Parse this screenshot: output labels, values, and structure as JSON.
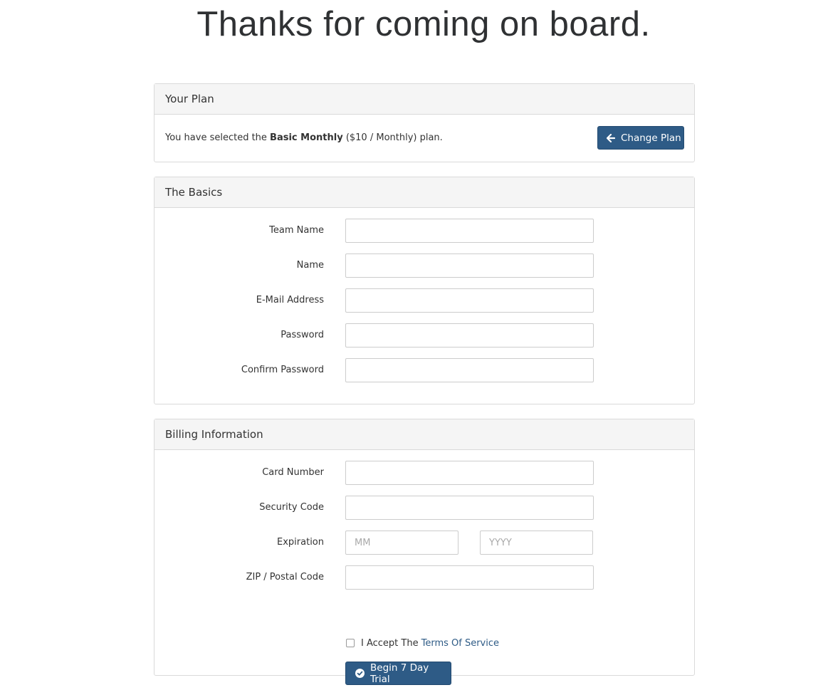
{
  "header": {
    "title": "Thanks for coming on board."
  },
  "plan_panel": {
    "heading": "Your Plan",
    "text_prefix": "You have selected the ",
    "plan_name": "Basic Monthly",
    "text_suffix": " ($10 / Monthly) plan.",
    "change_button_label": "Change Plan",
    "change_button_icon": "arrow-left-icon"
  },
  "basics_panel": {
    "heading": "The Basics",
    "fields": [
      {
        "label": "Team Name",
        "value": "",
        "placeholder": ""
      },
      {
        "label": "Name",
        "value": "",
        "placeholder": ""
      },
      {
        "label": "E-Mail Address",
        "value": "",
        "placeholder": ""
      },
      {
        "label": "Password",
        "value": "",
        "placeholder": ""
      },
      {
        "label": "Confirm Password",
        "value": "",
        "placeholder": ""
      }
    ]
  },
  "billing_panel": {
    "heading": "Billing Information",
    "card_number_label": "Card Number",
    "security_code_label": "Security Code",
    "expiration_label": "Expiration",
    "expiration_month_placeholder": "MM",
    "expiration_year_placeholder": "YYYY",
    "zip_label": "ZIP / Postal Code",
    "terms_prefix": "I Accept The",
    "terms_link": "Terms Of Service",
    "terms_checked": false,
    "submit_label": "Begin 7 Day Trial",
    "submit_icon": "check-circle-icon"
  },
  "colors": {
    "button_primary": "#2e5b86",
    "link": "#2e5b86",
    "panel_heading_bg": "#f5f5f5",
    "border": "#dadada"
  }
}
